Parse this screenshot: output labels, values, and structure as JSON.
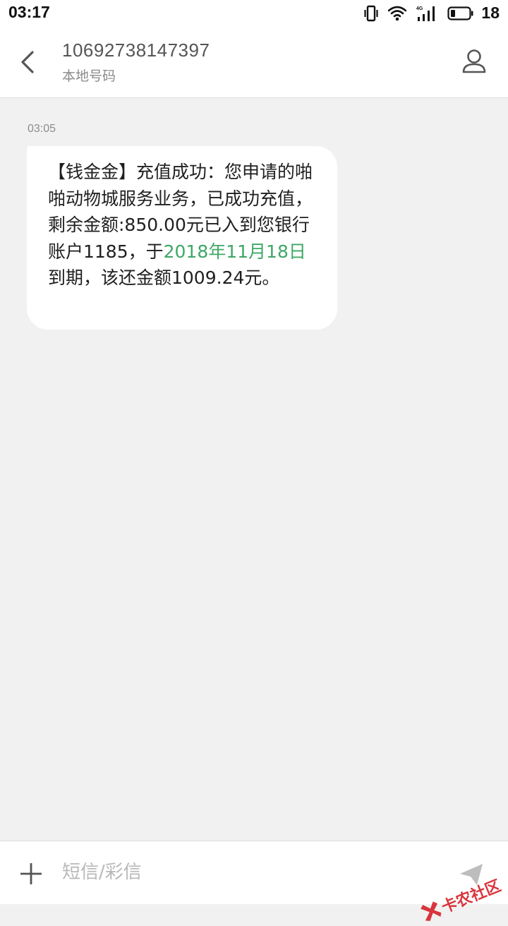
{
  "status_bar": {
    "time": "03:17",
    "network": "4G",
    "battery_level": "18",
    "icons": [
      "vibrate-icon",
      "wifi-icon",
      "signal-4g-icon",
      "battery-icon"
    ]
  },
  "header": {
    "contact_number": "10692738147397",
    "contact_subtitle": "本地号码",
    "back_icon": "chevron-left-icon",
    "contact_icon": "person-icon"
  },
  "thread": {
    "messages": [
      {
        "time": "03:05",
        "text_before": "【钱金金】充值成功：您申请的啪啪动物城服务业务，已成功充值，剩余金额:850.00元已入到您银行账户1185，于",
        "text_link": "2018年11月18日",
        "text_after": "到期，该还金额1009.24元。"
      }
    ]
  },
  "composer": {
    "placeholder": "短信/彩信",
    "add_icon": "plus-icon",
    "send_icon": "send-icon"
  },
  "watermark": {
    "text": "卡农社区"
  },
  "colors": {
    "link": "#3fa766",
    "background": "#f1f1f1",
    "bubble": "#ffffff"
  }
}
